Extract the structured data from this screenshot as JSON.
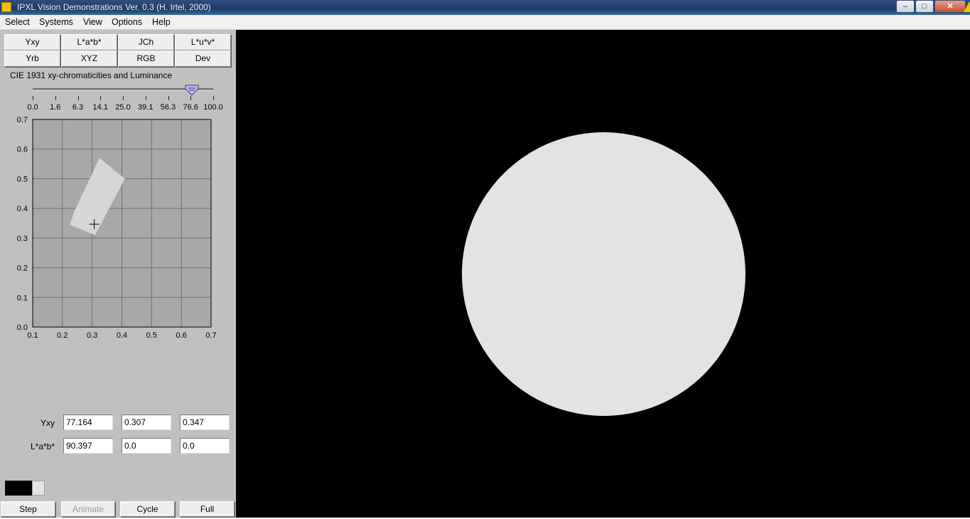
{
  "window": {
    "title": "IPXL Vision Demonstrations Ver. 0.3 (H. Irtel, 2000)",
    "minimize_glyph": "–",
    "maximize_glyph": "□",
    "close_glyph": "✕",
    "accent": "#1d3a63"
  },
  "menu": [
    "Select",
    "Systems",
    "View",
    "Options",
    "Help"
  ],
  "systems": {
    "row1": [
      "Yxy",
      "L*a*b*",
      "JCh",
      "L*u*v*"
    ],
    "row2": [
      "Yrb",
      "XYZ",
      "RGB",
      "Dev"
    ]
  },
  "caption": "CIE 1931 xy-chromaticities and Luminance",
  "slider": {
    "labels": [
      "0.0",
      "1.6",
      "6.3",
      "14.1",
      "25.0",
      "39.1",
      "56.3",
      "76.6",
      "100.0"
    ],
    "value": 77.164
  },
  "chart_data": {
    "type": "scatter",
    "title": "CIE 1931 xy-chromaticities and Luminance",
    "x_ticks": [
      "0.1",
      "0.2",
      "0.3",
      "0.4",
      "0.5",
      "0.6",
      "0.7"
    ],
    "y_ticks": [
      "0.0",
      "0.1",
      "0.2",
      "0.3",
      "0.4",
      "0.5",
      "0.6",
      "0.7"
    ],
    "xlim": [
      0.1,
      0.7
    ],
    "ylim": [
      0.0,
      0.7
    ],
    "grid": true,
    "gamut_polygon": [
      [
        0.325,
        0.57
      ],
      [
        0.41,
        0.5
      ],
      [
        0.31,
        0.31
      ],
      [
        0.225,
        0.345
      ],
      [
        0.24,
        0.39
      ]
    ],
    "point": {
      "x": 0.307,
      "y": 0.347
    },
    "background": "#a8a8a8",
    "gamut_color": "#d6d6d6"
  },
  "fields": {
    "yxy": {
      "label": "Yxy",
      "values": [
        "77.164",
        "0.307",
        "0.347"
      ]
    },
    "lab": {
      "label": "L*a*b*",
      "values": [
        "90.397",
        "0.0",
        "0.0"
      ]
    }
  },
  "buttons": {
    "step": "Step",
    "animate": "Animate",
    "cycle": "Cycle",
    "full": "Full"
  },
  "stimulus": {
    "color": "#e3e3e3",
    "background": "#000000"
  }
}
